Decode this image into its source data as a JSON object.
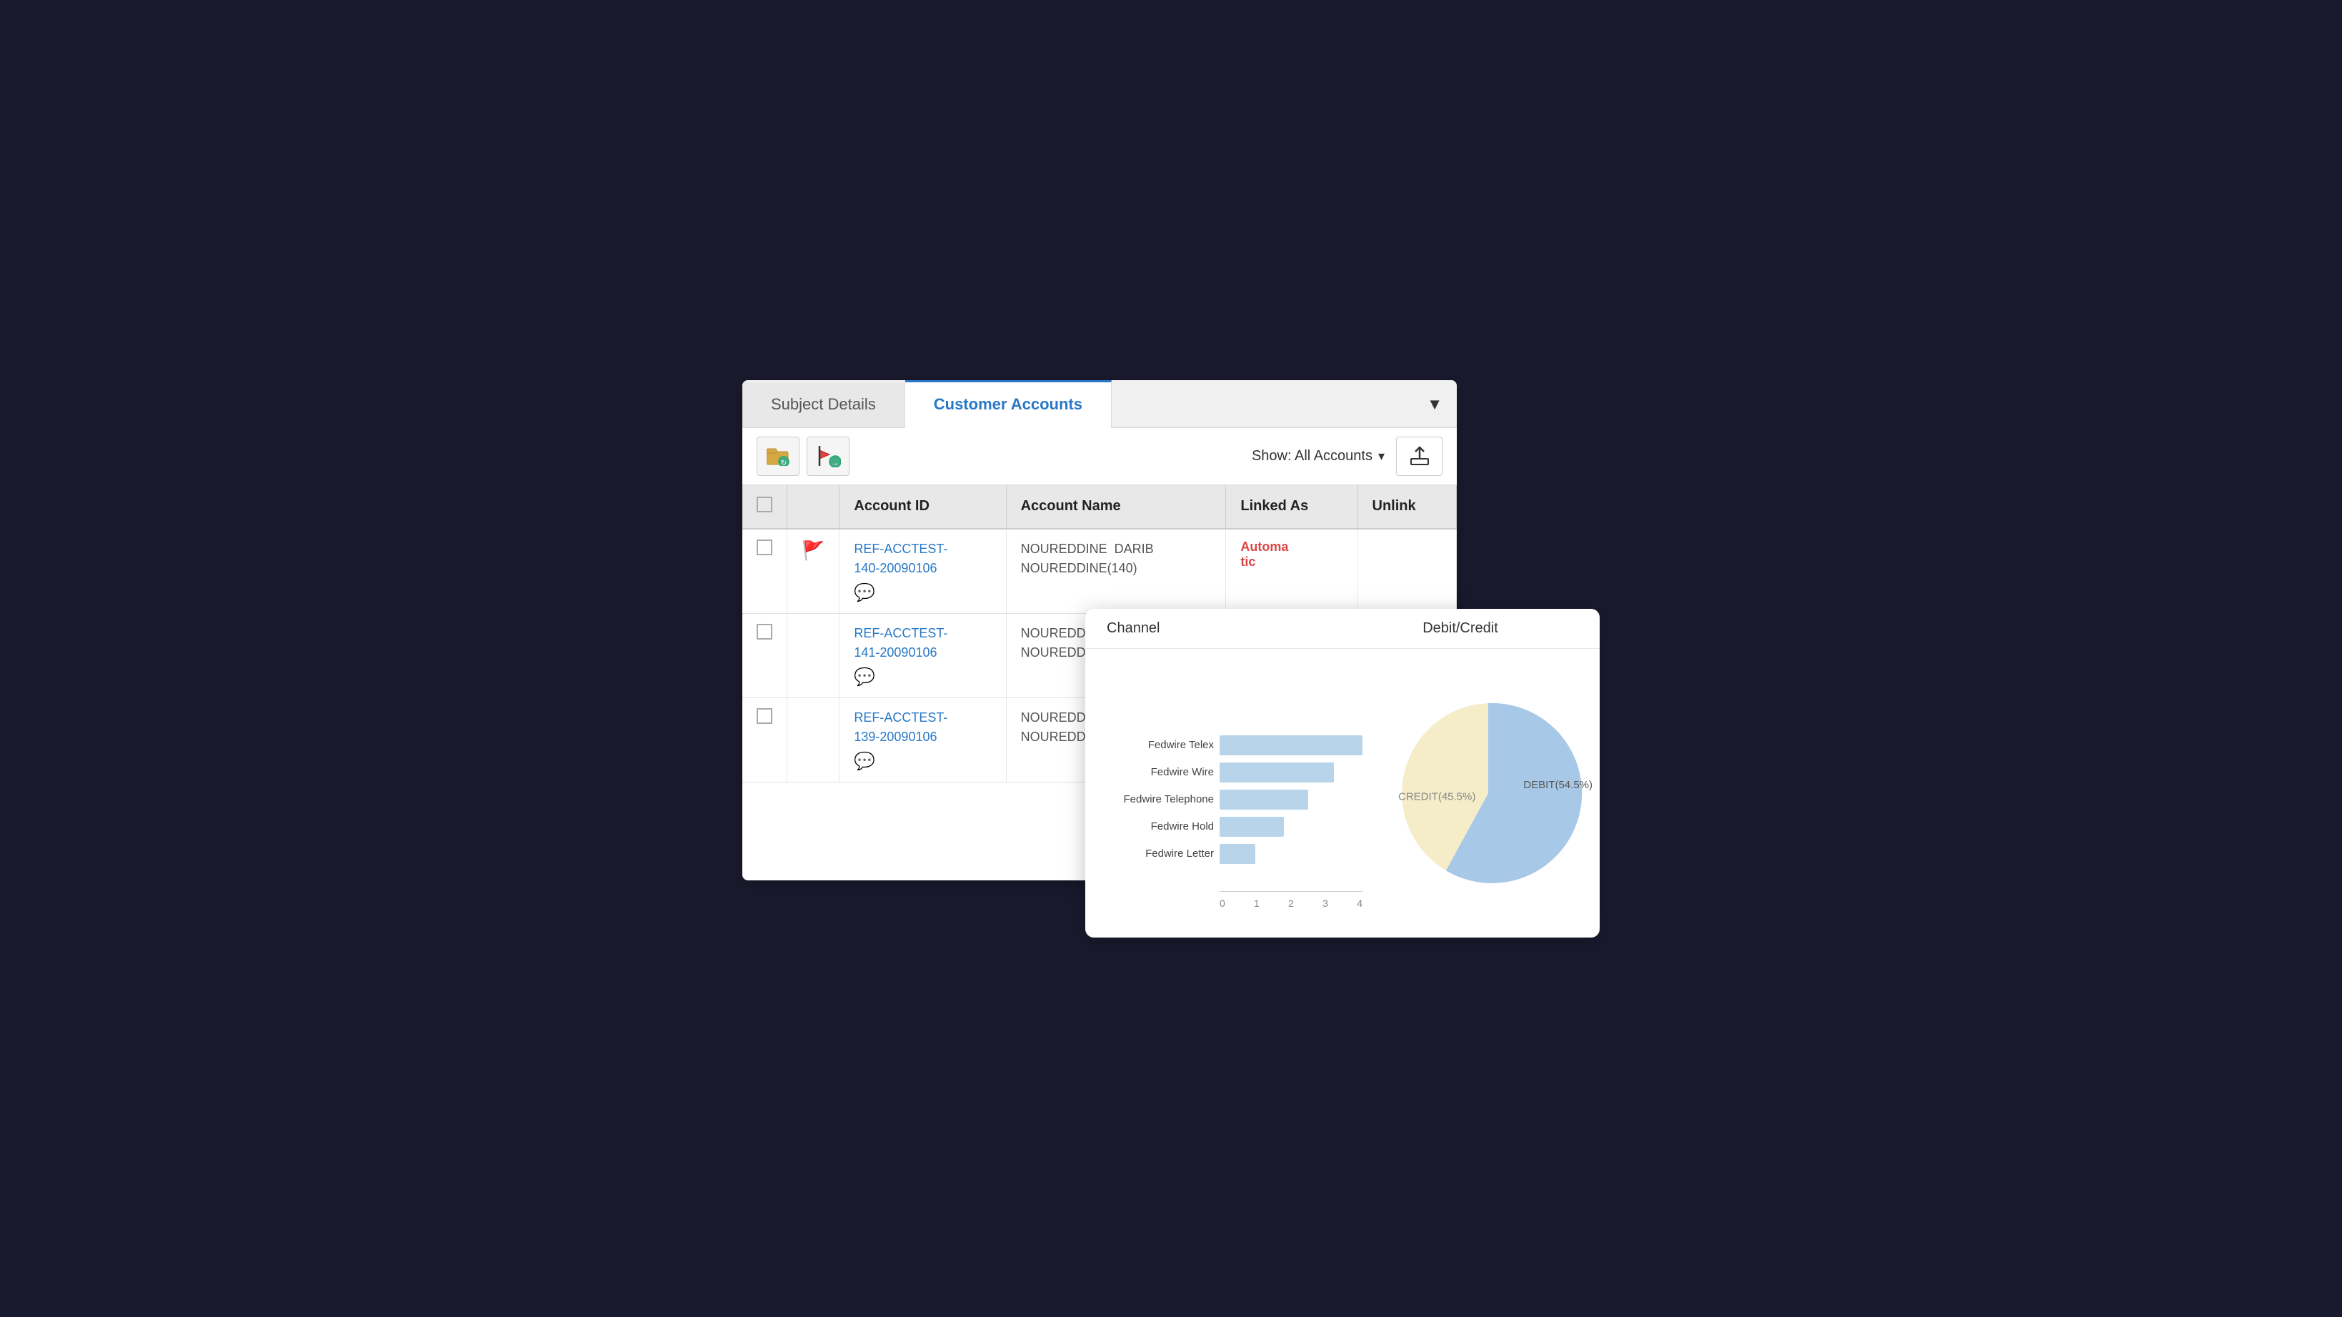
{
  "tabs": {
    "subject_details": "Subject Details",
    "customer_accounts": "Customer Accounts",
    "active_tab": "customer_accounts"
  },
  "toolbar": {
    "show_label": "Show: All Accounts",
    "dropdown_arrow": "▾",
    "export_icon": "⬆"
  },
  "table": {
    "headers": {
      "checkbox": "",
      "flag": "",
      "account_id": "Account ID",
      "account_name": "Account Name",
      "linked_as": "Linked As",
      "unlink": "Unlink"
    },
    "rows": [
      {
        "checkbox": "",
        "flag": "🚩",
        "account_id": "REF-ACCTEST-140-20090106",
        "account_name": "NOUREDDINE  DARIB\nNOUREDDINE(140)",
        "linked_as": "Automatic",
        "has_comment": true
      },
      {
        "checkbox": "",
        "flag": "",
        "account_id": "REF-ACCTEST-141-20090106",
        "account_name": "NOUREDDINE\nNOUREDDINE",
        "linked_as": "",
        "has_comment": true
      },
      {
        "checkbox": "",
        "flag": "",
        "account_id": "REF-ACCTEST-139-20090106",
        "account_name": "NOUREDDINE\nNOUREDDINE",
        "linked_as": "",
        "has_comment": true
      }
    ]
  },
  "chart": {
    "header_channel": "Channel",
    "header_debit_credit": "Debit/Credit",
    "bars": [
      {
        "label": "Fedwire Telex",
        "value": 4,
        "max": 4
      },
      {
        "label": "Fedwire Wire",
        "value": 3.2,
        "max": 4
      },
      {
        "label": "Fedwire Telephone",
        "value": 2.5,
        "max": 4
      },
      {
        "label": "Fedwire Hold",
        "value": 1.8,
        "max": 4
      },
      {
        "label": "Fedwire Letter",
        "value": 1.0,
        "max": 4
      }
    ],
    "x_axis": [
      "0",
      "1",
      "2",
      "3",
      "4"
    ],
    "pie": {
      "credit_label": "CREDIT(45.5%)",
      "debit_label": "DEBIT(54.5%)",
      "credit_pct": 45.5,
      "debit_pct": 54.5,
      "credit_color": "#f5ecc8",
      "debit_color": "#a8c8e8"
    }
  }
}
